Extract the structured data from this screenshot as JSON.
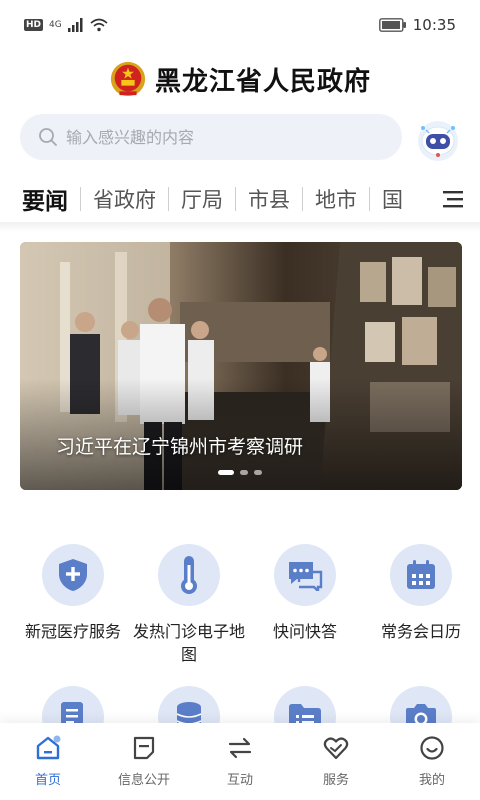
{
  "status_bar": {
    "hd": "HD",
    "network": "4G",
    "time": "10:35"
  },
  "app": {
    "title": "黑龙江省人民政府"
  },
  "search": {
    "placeholder": "输入感兴趣的内容"
  },
  "tabs": [
    "要闻",
    "省政府",
    "厅局",
    "市县",
    "地市",
    "国"
  ],
  "banner": {
    "caption": "习近平在辽宁锦州市考察调研",
    "slide_count": 3,
    "active_slide": 0
  },
  "services": [
    {
      "label": "新冠医疗服务",
      "icon": "shield-plus-icon"
    },
    {
      "label": "发热门诊电子地图",
      "icon": "thermometer-icon"
    },
    {
      "label": "快问快答",
      "icon": "chat-icon"
    },
    {
      "label": "常务会日历",
      "icon": "calendar-icon"
    },
    {
      "label": "",
      "icon": "document-icon"
    },
    {
      "label": "",
      "icon": "database-icon"
    },
    {
      "label": "",
      "icon": "folder-icon"
    },
    {
      "label": "",
      "icon": "camera-icon"
    }
  ],
  "bottom_nav": [
    {
      "label": "首页",
      "icon": "home-icon",
      "active": true
    },
    {
      "label": "信息公开",
      "icon": "info-icon",
      "active": false
    },
    {
      "label": "互动",
      "icon": "interact-icon",
      "active": false
    },
    {
      "label": "服务",
      "icon": "service-icon",
      "active": false
    },
    {
      "label": "我的",
      "icon": "profile-icon",
      "active": false
    }
  ],
  "colors": {
    "accent": "#2f6fd6",
    "icon_blue": "#5b7ec9",
    "circle_bg": "#dfe7f6",
    "search_bg": "#eef1f7"
  }
}
